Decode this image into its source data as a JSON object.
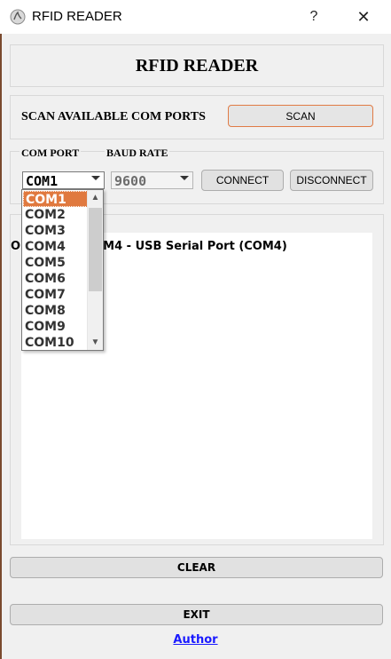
{
  "window": {
    "title": "RFID READER",
    "help": "?",
    "close": "✕"
  },
  "header": {
    "title": "RFID READER"
  },
  "scan": {
    "label": "SCAN AVAILABLE COM PORTS",
    "button": "SCAN"
  },
  "connection": {
    "com_label": "COM PORT",
    "baud_label": "BAUD RATE",
    "com_value": "COM1",
    "baud_value": "9600",
    "connect": "CONNECT",
    "disconnect": "DISCONNECT"
  },
  "log": {
    "line": "Open port: COM4 - USB Serial Port (COM4)"
  },
  "dropdown": {
    "items": [
      "COM1",
      "COM2",
      "COM3",
      "COM4",
      "COM5",
      "COM6",
      "COM7",
      "COM8",
      "COM9",
      "COM10"
    ],
    "selected_index": 0
  },
  "buttons": {
    "clear": "CLEAR",
    "exit": "EXIT"
  },
  "author": {
    "label": "Author"
  },
  "colors": {
    "accent": "#e0793f",
    "link": "#1a1aff"
  }
}
